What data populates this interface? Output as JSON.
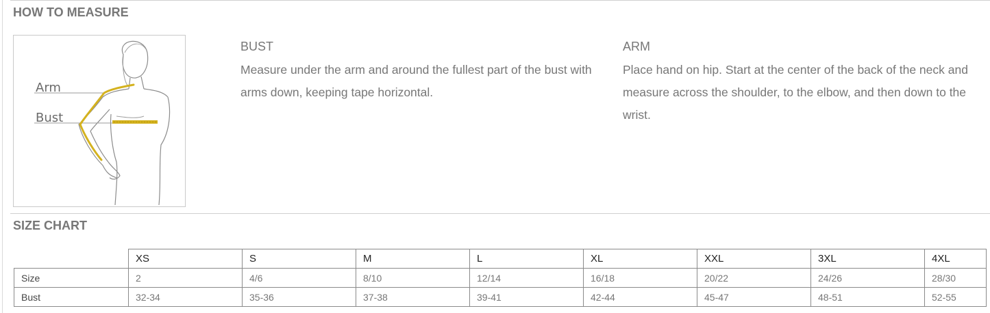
{
  "how_to_measure": {
    "title": "HOW TO MEASURE",
    "figure_labels": {
      "arm": "Arm",
      "bust": "Bust"
    },
    "bust": {
      "heading": "BUST",
      "text": "Measure under the arm and around the fullest part of the bust with arms down, keeping tape horizontal."
    },
    "arm": {
      "heading": "ARM",
      "text": "Place hand on hip. Start at the center of the back of the neck and measure across the shoulder, to the elbow, and then down to the wrist."
    }
  },
  "size_chart": {
    "title": "SIZE CHART",
    "columns": [
      "XS",
      "S",
      "M",
      "L",
      "XL",
      "XXL",
      "3XL",
      "4XL"
    ],
    "rows": [
      {
        "label": "Size",
        "values": [
          "2",
          "4/6",
          "8/10",
          "12/14",
          "16/18",
          "20/22",
          "24/26",
          "28/30"
        ]
      },
      {
        "label": "Bust",
        "values": [
          "32-34",
          "35-36",
          "37-38",
          "39-41",
          "42-44",
          "45-47",
          "48-51",
          "52-55"
        ]
      }
    ]
  },
  "colors": {
    "tape": "#d4b21f",
    "outline": "#8c8c8c",
    "text": "#777777"
  }
}
